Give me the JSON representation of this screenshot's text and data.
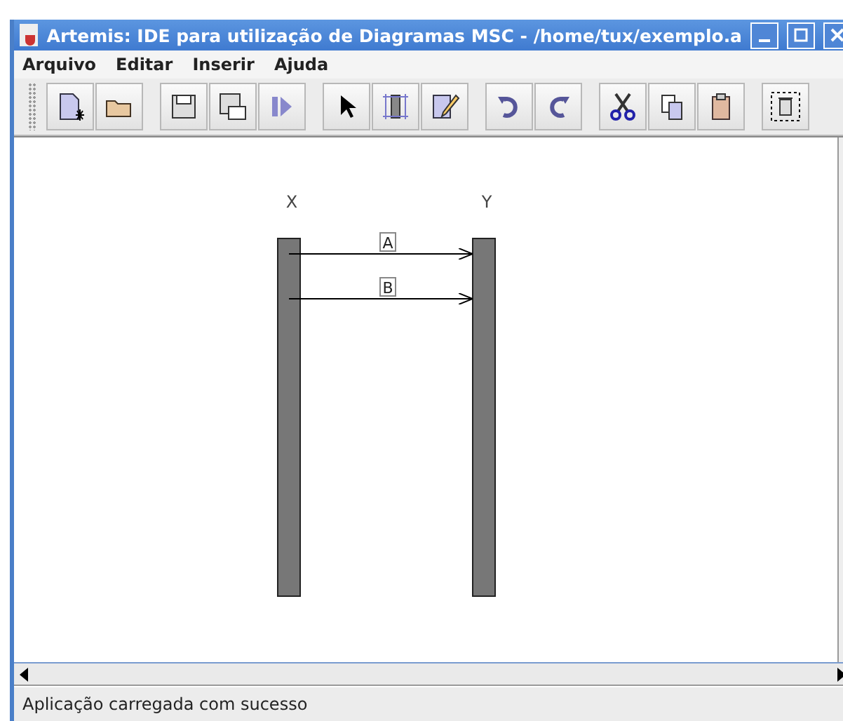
{
  "window": {
    "title": "Artemis: IDE para utilização de Diagramas MSC - /home/tux/exemplo.a"
  },
  "menu": [
    {
      "label": "Arquivo"
    },
    {
      "label": "Editar"
    },
    {
      "label": "Inserir"
    },
    {
      "label": "Ajuda"
    }
  ],
  "toolbar": [
    {
      "kind": "new"
    },
    {
      "kind": "open"
    },
    {
      "kind": "sep"
    },
    {
      "kind": "save"
    },
    {
      "kind": "saveas"
    },
    {
      "kind": "run"
    },
    {
      "kind": "sep"
    },
    {
      "kind": "pointer"
    },
    {
      "kind": "instance"
    },
    {
      "kind": "edit"
    },
    {
      "kind": "sep"
    },
    {
      "kind": "undo"
    },
    {
      "kind": "redo"
    },
    {
      "kind": "sep"
    },
    {
      "kind": "cut"
    },
    {
      "kind": "copy"
    },
    {
      "kind": "paste"
    },
    {
      "kind": "sep"
    },
    {
      "kind": "delete"
    }
  ],
  "diagram": {
    "instances": [
      {
        "name": "X"
      },
      {
        "name": "Y"
      }
    ],
    "messages": [
      {
        "label": "A"
      },
      {
        "label": "B"
      }
    ]
  },
  "status_bar": "Aplicação carregada com sucesso"
}
